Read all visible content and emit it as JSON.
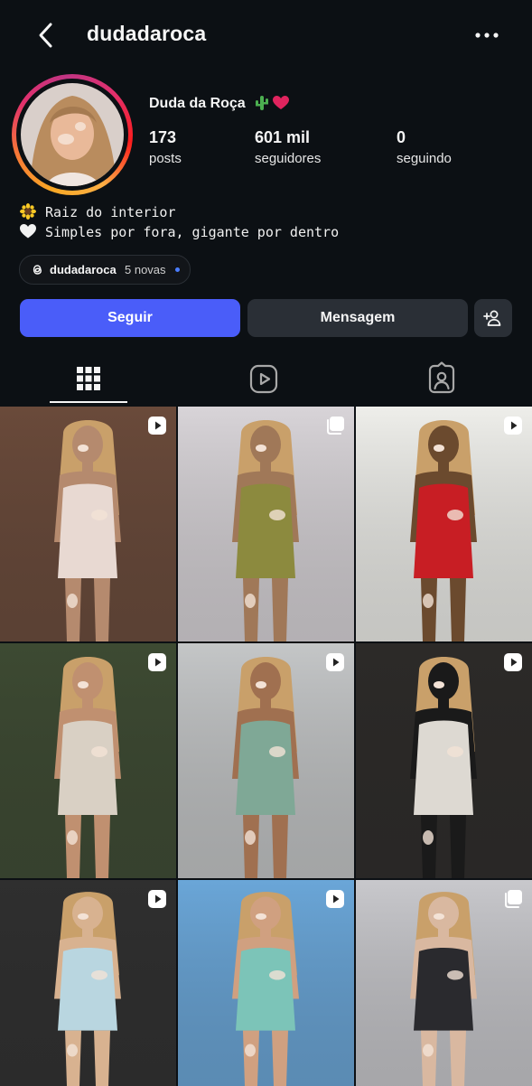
{
  "header": {
    "username": "dudadaroca",
    "back_icon": "chevron-left-icon",
    "more_icon": "more-horizontal-icon"
  },
  "profile": {
    "display_name": "Duda da Roça",
    "name_emojis": [
      "cactus-emoji",
      "red-heart-emoji"
    ],
    "stats": {
      "posts": {
        "value": "173",
        "label": "posts"
      },
      "followers": {
        "value": "601 mil",
        "label": "seguidores"
      },
      "following": {
        "value": "0",
        "label": "seguindo"
      }
    },
    "bio": [
      {
        "icon": "sunflower-emoji",
        "text": "Raiz do interior"
      },
      {
        "icon": "white-heart-emoji",
        "text": "Simples por fora, gigante por dentro"
      }
    ],
    "threads": {
      "handle": "dudadaroca",
      "new_label": "5 novas"
    }
  },
  "actions": {
    "follow_label": "Seguir",
    "message_label": "Mensagem",
    "add_user_icon": "add-person-icon"
  },
  "tabs": [
    {
      "name": "grid",
      "icon": "grid-icon",
      "active": true
    },
    {
      "name": "reels",
      "icon": "reels-icon",
      "active": false
    },
    {
      "name": "tagged",
      "icon": "tagged-icon",
      "active": false
    }
  ],
  "posts": [
    {
      "type": "reel",
      "colors": [
        "#6a4a3a",
        "#e8d9d2",
        "#b58a6e"
      ]
    },
    {
      "type": "carousel",
      "colors": [
        "#d8d4d8",
        "#8c8a3e",
        "#a07858"
      ]
    },
    {
      "type": "reel",
      "colors": [
        "#eeeeea",
        "#c81e24",
        "#6b4a2e"
      ]
    },
    {
      "type": "reel",
      "colors": [
        "#3d4a32",
        "#d9d0c4",
        "#c09070"
      ]
    },
    {
      "type": "reel",
      "colors": [
        "#c4c6c7",
        "#7fa896",
        "#a07050"
      ]
    },
    {
      "type": "reel",
      "colors": [
        "#2c2a28",
        "#ddd9d2",
        "#1a1a1a"
      ]
    },
    {
      "type": "reel",
      "colors": [
        "#2f2f2f",
        "#b9d6e0",
        "#d8b290"
      ]
    },
    {
      "type": "reel",
      "colors": [
        "#6aa6d8",
        "#7cc4b8",
        "#d0a080"
      ]
    },
    {
      "type": "carousel",
      "colors": [
        "#c8c8cc",
        "#2a2a2e",
        "#d9b8a0"
      ]
    }
  ],
  "accent": "#4a5df9"
}
